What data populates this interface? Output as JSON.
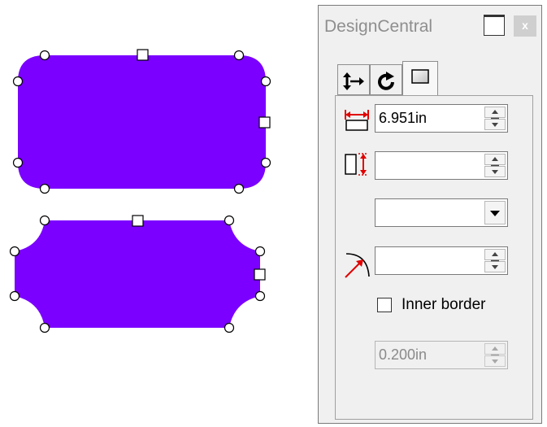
{
  "panel": {
    "title": "DesignCentral",
    "close_glyph": "x",
    "tabs": [
      {
        "icon": "resize-arrows-icon"
      },
      {
        "icon": "rotate-icon"
      },
      {
        "icon": "shape-frame-icon",
        "active": true
      }
    ]
  },
  "fields": {
    "width": {
      "value": "6.951in",
      "icon": "width-icon"
    },
    "height": {
      "value": "",
      "icon": "height-icon"
    },
    "corner_style": {
      "value": ""
    },
    "corner_radius": {
      "value": "",
      "icon": "corner-radius-icon"
    },
    "inner_border": {
      "label": "Inner border",
      "checked": false
    },
    "border_width": {
      "value": "0.200in",
      "disabled": true
    }
  },
  "colors": {
    "shape_fill": "#7b00ff",
    "accent_red": "#e00000"
  }
}
